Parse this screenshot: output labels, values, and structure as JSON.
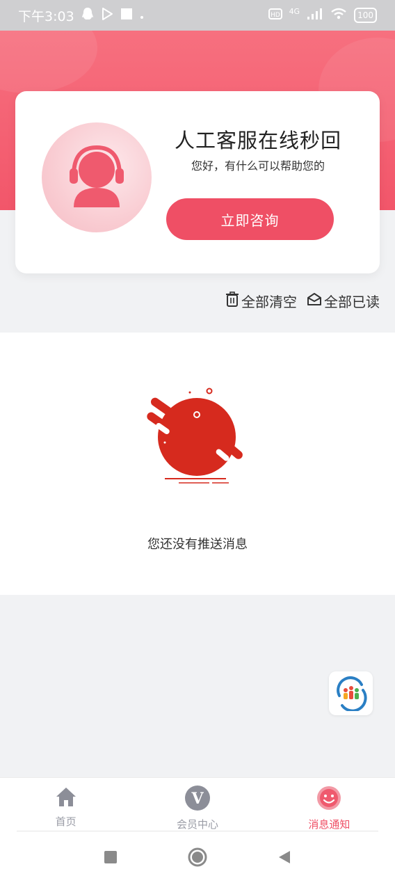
{
  "status_bar": {
    "time": "下午3:03",
    "network": "4G",
    "battery": "100"
  },
  "service_card": {
    "title": "人工客服在线秒回",
    "subtitle": "您好，有什么可以帮助您的",
    "button_label": "立即咨询"
  },
  "actions": {
    "clear_all": "全部清空",
    "mark_all_read": "全部已读"
  },
  "empty_state": {
    "text": "您还没有推送消息"
  },
  "tabs": [
    {
      "label": "首页",
      "icon": "home-icon",
      "active": false
    },
    {
      "label": "会员中心",
      "icon": "vip-icon",
      "active": false
    },
    {
      "label": "消息通知",
      "icon": "smile-message-icon",
      "active": true
    }
  ],
  "colors": {
    "accent": "#ef4f65",
    "header": "#f2566a",
    "tab_inactive": "#9a9ca6"
  }
}
